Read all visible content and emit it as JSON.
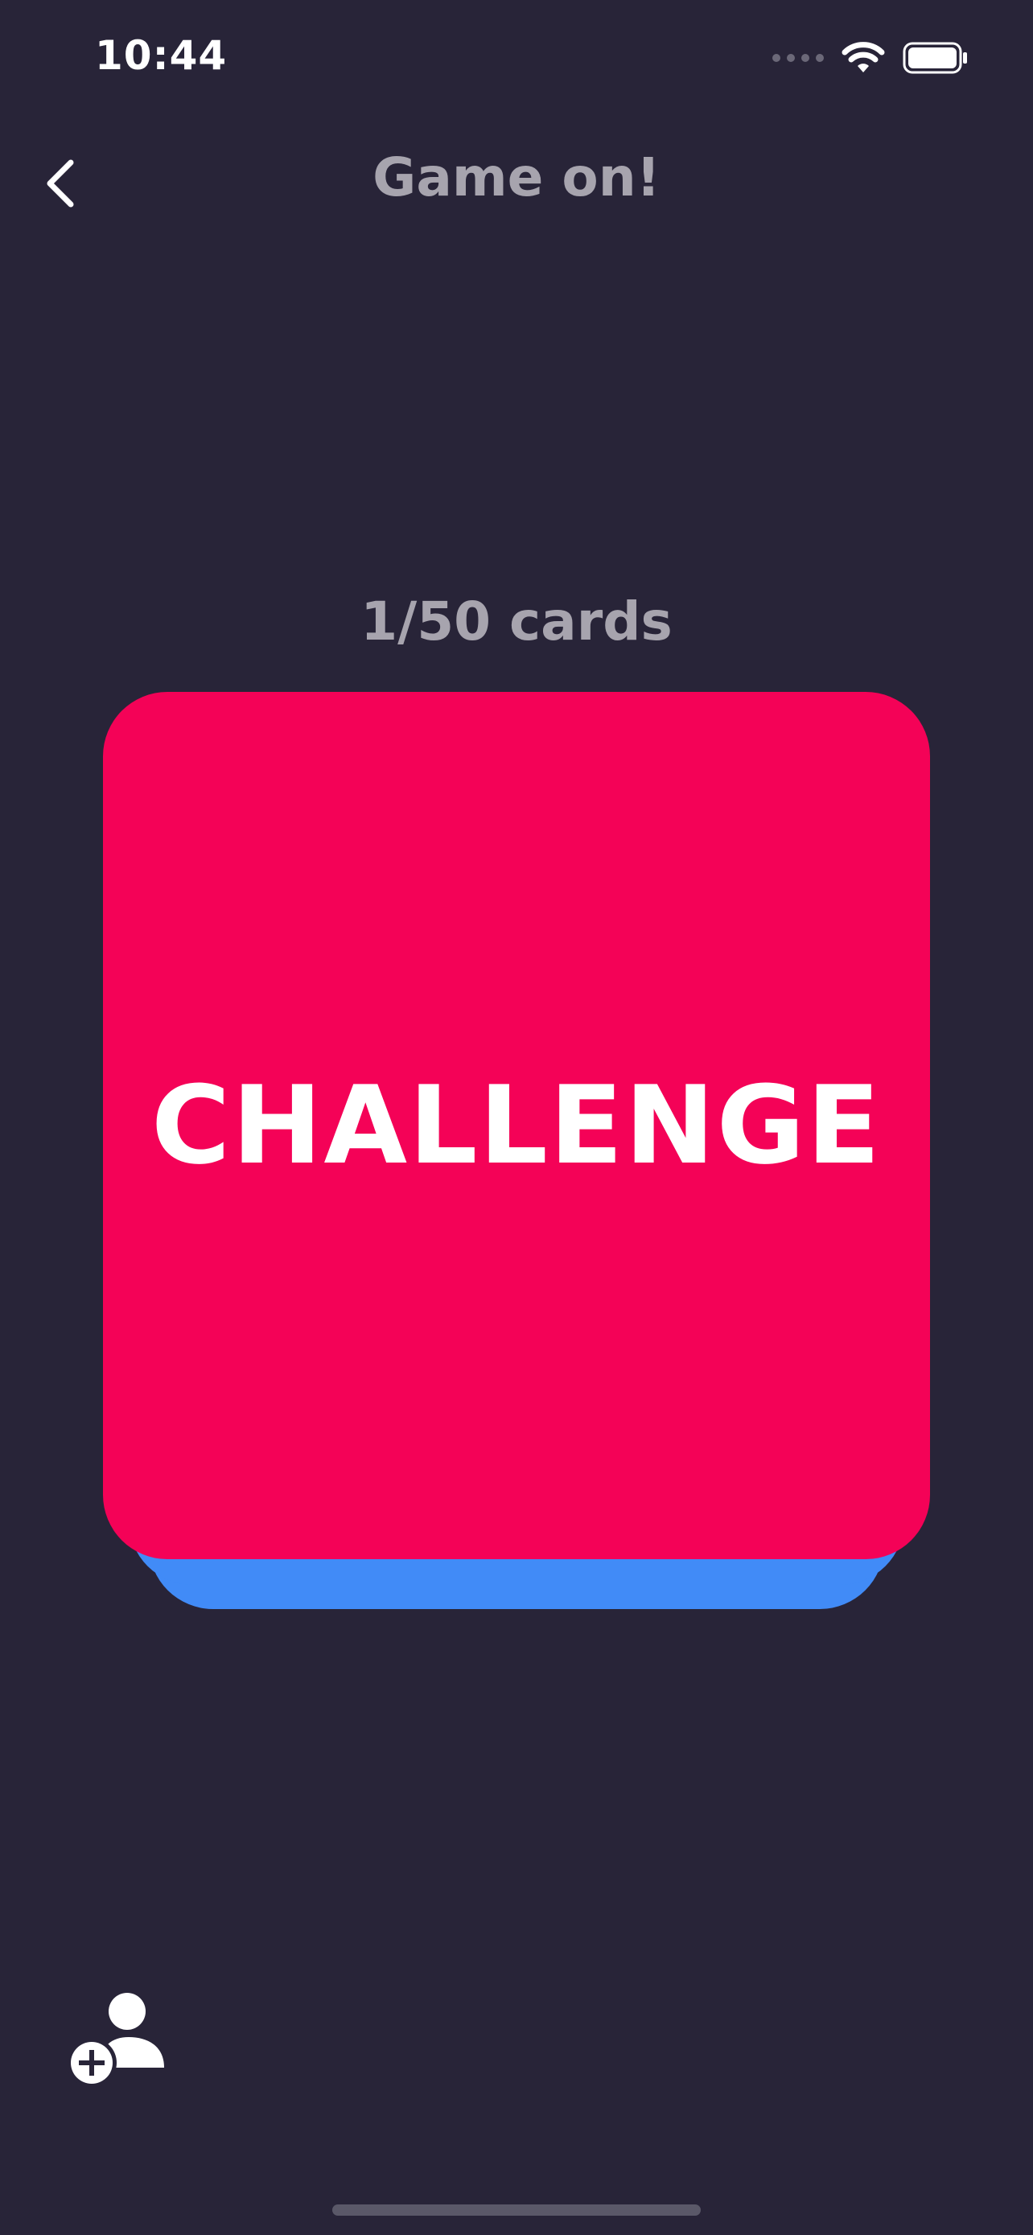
{
  "status_bar": {
    "time": "10:44"
  },
  "header": {
    "title": "Game on!",
    "back_icon": "chevron-left-icon"
  },
  "game": {
    "counter": "1/50 cards",
    "card_label": "CHALLENGE"
  },
  "actions": {
    "add_player_icon": "add-person-icon"
  },
  "colors": {
    "background": "#282438",
    "card_front": "#f40257",
    "card_back": "#418bf7",
    "muted_text": "#a7a4ae"
  }
}
